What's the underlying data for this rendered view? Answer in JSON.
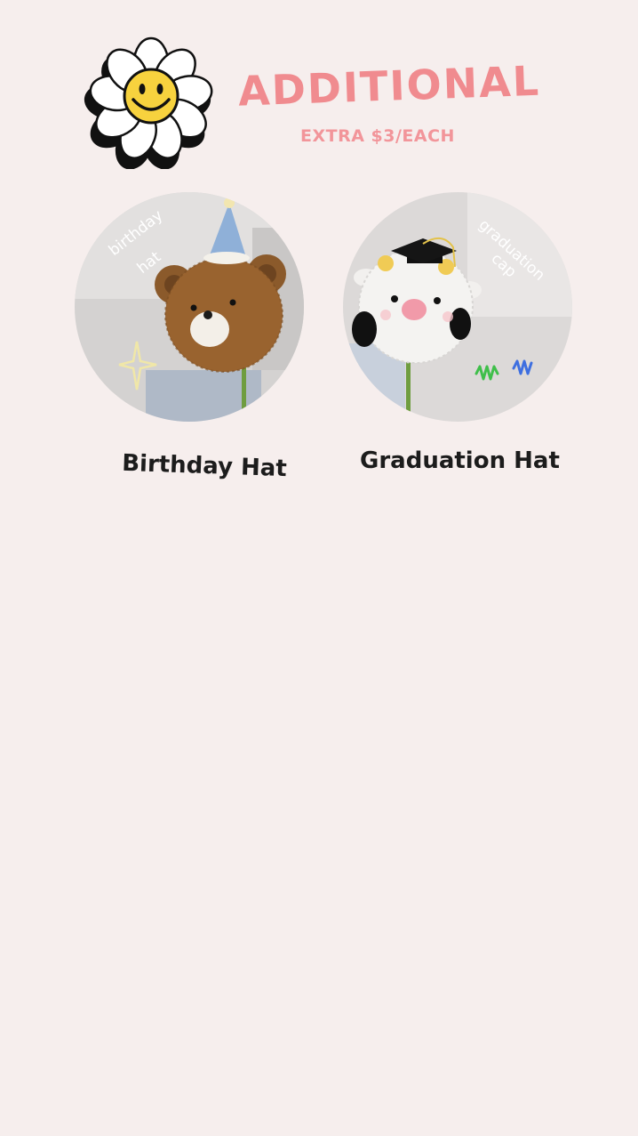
{
  "header": {
    "title": "ADDITIONAL",
    "subtitle": "EXTRA $3/EACH",
    "logo_icon": "smiley-daisy-icon"
  },
  "items": [
    {
      "caption": "Birthday Hat",
      "photo_label": [
        "birthday",
        "hat"
      ],
      "photo_icon": "crochet-bear-birthday-hat"
    },
    {
      "caption": "Graduation Hat",
      "photo_label": [
        "graduation",
        "cap"
      ],
      "photo_icon": "crochet-cow-graduation-cap"
    }
  ],
  "colors": {
    "background": "#f6eeed",
    "accent_pink": "#f08b8f",
    "caption_text": "#1c1c1c"
  }
}
